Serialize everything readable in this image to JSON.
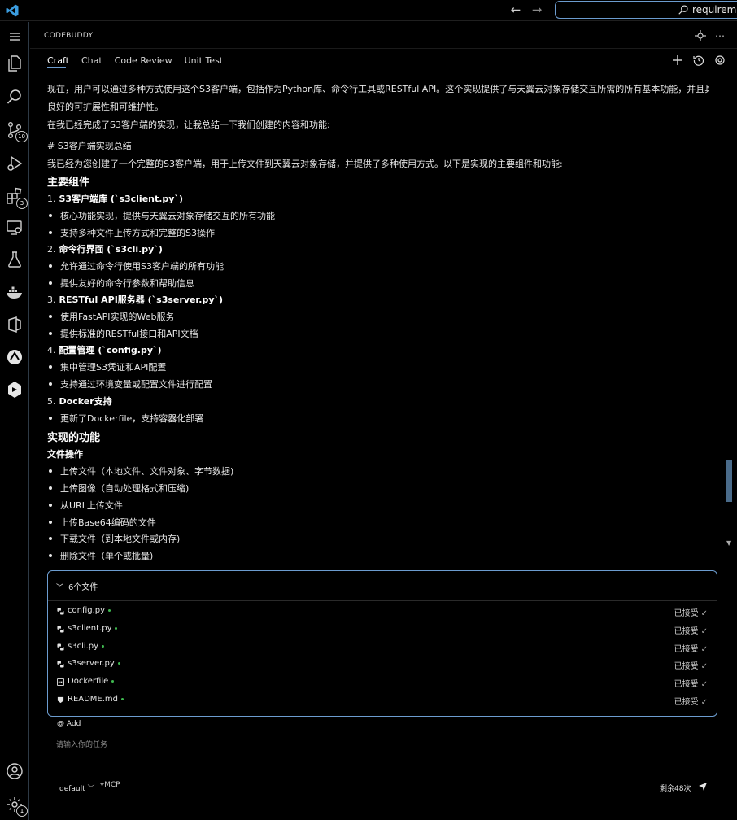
{
  "titlebar": {
    "command_center_text": "requireme",
    "back_icon": "arrow-left-icon",
    "forward_icon": "arrow-right-icon"
  },
  "activitybar": {
    "items": [
      {
        "name": "explorer-icon"
      },
      {
        "name": "search-icon"
      },
      {
        "name": "source-control-icon",
        "badge": "10"
      },
      {
        "name": "run-debug-icon"
      },
      {
        "name": "extensions-icon",
        "badge": "3"
      },
      {
        "name": "remote-explorer-icon"
      },
      {
        "name": "testing-icon"
      },
      {
        "name": "docker-icon"
      },
      {
        "name": "office-icon"
      },
      {
        "name": "codebuddy-icon"
      },
      {
        "name": "plugin-icon"
      }
    ],
    "accounts_icon": "account-icon",
    "settings_icon": "gear-icon",
    "settings_badge": "1"
  },
  "panel": {
    "title": "CODEBUDDY",
    "tabs": [
      "Craft",
      "Chat",
      "Code Review",
      "Unit Test"
    ],
    "active_tab": "Craft"
  },
  "chat": {
    "lines": [
      {
        "kind": "p",
        "text": "现在，用户可以通过多种方式使用这个S3客户端，包括作为Python库、命令行工具或RESTful API。这个实现提供了与天翼云对象存储交互所需的所有基本功能，并且具有"
      },
      {
        "kind": "p",
        "text": "良好的可扩展性和可维护性。"
      },
      {
        "kind": "p",
        "text": "在我已经完成了S3客户端的实现，让我总结一下我们创建的内容和功能:"
      },
      {
        "kind": "p",
        "text": "# S3客户端实现总结"
      },
      {
        "kind": "p",
        "text": "我已经为您创建了一个完整的S3客户端，用于上传文件到天翼云对象存储，并提供了多种使用方式。以下是实现的主要组件和功能:"
      },
      {
        "kind": "h2",
        "text": "主要组件"
      },
      {
        "kind": "num",
        "num": "1.",
        "text": "S3客户端库 (`s3client.py`)"
      },
      {
        "kind": "li",
        "text": "核心功能实现，提供与天翼云对象存储交互的所有功能"
      },
      {
        "kind": "li",
        "text": "支持多种文件上传方式和完整的S3操作"
      },
      {
        "kind": "num",
        "num": "2.",
        "text": "命令行界面 (`s3cli.py`)"
      },
      {
        "kind": "li",
        "text": "允许通过命令行使用S3客户端的所有功能"
      },
      {
        "kind": "li",
        "text": "提供友好的命令行参数和帮助信息"
      },
      {
        "kind": "num",
        "num": "3.",
        "text": "RESTful API服务器 (`s3server.py`)"
      },
      {
        "kind": "li",
        "text": "使用FastAPI实现的Web服务"
      },
      {
        "kind": "li",
        "text": "提供标准的RESTful接口和API文档"
      },
      {
        "kind": "num",
        "num": "4.",
        "text": "配置管理 (`config.py`)"
      },
      {
        "kind": "li",
        "text": "集中管理S3凭证和API配置"
      },
      {
        "kind": "li",
        "text": "支持通过环境变量或配置文件进行配置"
      },
      {
        "kind": "num",
        "num": "5.",
        "text": "Docker支持"
      },
      {
        "kind": "li",
        "text": "更新了Dockerfile，支持容器化部署"
      },
      {
        "kind": "h2",
        "text": "实现的功能"
      },
      {
        "kind": "h4",
        "text": "文件操作"
      },
      {
        "kind": "li",
        "text": "上传文件（本地文件、文件对象、字节数据)"
      },
      {
        "kind": "li",
        "text": "上传图像（自动处理格式和压缩)"
      },
      {
        "kind": "li",
        "text": "从URL上传文件"
      },
      {
        "kind": "li",
        "text": "上传Base64编码的文件"
      },
      {
        "kind": "li",
        "text": "下载文件（到本地文件或内存)"
      },
      {
        "kind": "li",
        "text": "删除文件（单个或批量)"
      }
    ]
  },
  "files": {
    "header": "6个文件",
    "items": [
      {
        "name": "config.py",
        "status": "已接受",
        "icon": "python-file-icon"
      },
      {
        "name": "s3client.py",
        "status": "已接受",
        "icon": "python-file-icon"
      },
      {
        "name": "s3cli.py",
        "status": "已接受",
        "icon": "python-file-icon"
      },
      {
        "name": "s3server.py",
        "status": "已接受",
        "icon": "python-file-icon"
      },
      {
        "name": "Dockerfile",
        "status": "已接受",
        "icon": "docker-file-icon"
      },
      {
        "name": "README.md",
        "status": "已接受",
        "icon": "markdown-file-icon"
      }
    ]
  },
  "input": {
    "add_label": "@ Add",
    "placeholder": "请输入你的任务",
    "model": "default",
    "mcp_label": "MCP",
    "remaining": "剩余48次"
  },
  "colors": {
    "accent": "#6c9ccf",
    "scrollbar": "#4a6b8a",
    "status_dot": "#3fb950"
  }
}
